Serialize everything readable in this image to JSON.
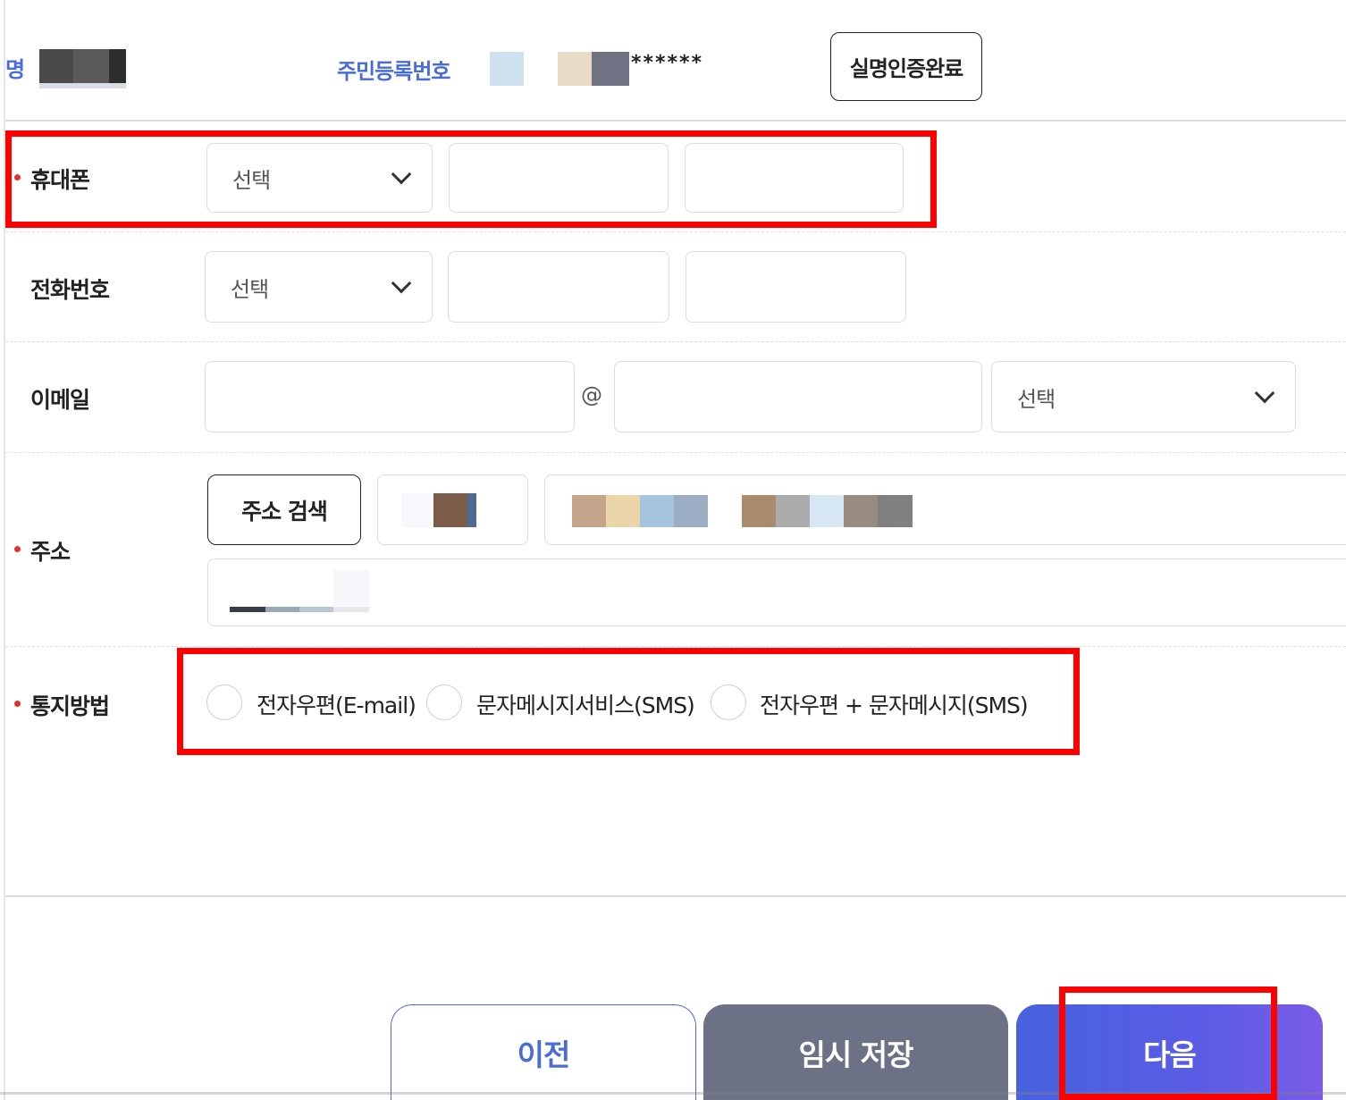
{
  "header": {
    "name_label_partial": "명",
    "resident_number_label": "주민등록번호",
    "resident_number_masked": "******",
    "verify_button": "실명인증완료"
  },
  "mobile": {
    "label": "휴대폰",
    "required": true,
    "select_value": "선택",
    "field2_value": "",
    "field3_value": ""
  },
  "phone": {
    "label": "전화번호",
    "select_value": "선택",
    "field2_value": "",
    "field3_value": ""
  },
  "email": {
    "label": "이메일",
    "local_value": "",
    "at_symbol": "@",
    "domain_value": "",
    "domain_select_value": "선택"
  },
  "address": {
    "label": "주소",
    "required": true,
    "search_button": "주소 검색"
  },
  "notification": {
    "label": "통지방법",
    "required": true,
    "options": [
      {
        "label": "전자우편(E-mail)",
        "checked": false
      },
      {
        "label": "문자메시지서비스(SMS)",
        "checked": false
      },
      {
        "label": "전자우편 + 문자메시지(SMS)",
        "checked": false
      }
    ]
  },
  "footer": {
    "prev_button": "이전",
    "temp_save_button": "임시 저장",
    "next_button": "다음"
  },
  "colors": {
    "accent_blue": "#4a6cd8",
    "highlight_red": "#ff0000",
    "required_dot": "#e5302c",
    "save_button_bg": "#6d7185"
  }
}
